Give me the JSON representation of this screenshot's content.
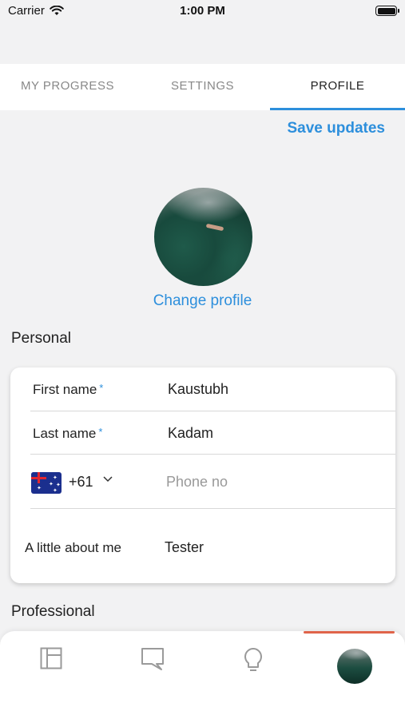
{
  "status_bar": {
    "carrier": "Carrier",
    "time": "1:00 PM"
  },
  "tabs": [
    {
      "label": "MY PROGRESS",
      "active": false
    },
    {
      "label": "SETTINGS",
      "active": false
    },
    {
      "label": "PROFILE",
      "active": true
    }
  ],
  "header": {
    "save_label": "Save updates"
  },
  "profile": {
    "change_label": "Change profile"
  },
  "sections": {
    "personal": "Personal",
    "professional": "Professional"
  },
  "form": {
    "first_name": {
      "label": "First name",
      "required_mark": "*",
      "value": "Kaustubh"
    },
    "last_name": {
      "label": "Last name",
      "required_mark": "*",
      "value": "Kadam"
    },
    "phone": {
      "country_code": "+61",
      "placeholder": "Phone no",
      "value": "",
      "flag_icon": "australia-flag-icon"
    },
    "about": {
      "label": "A little about me",
      "value": "Tester"
    }
  },
  "bottom_nav": [
    {
      "icon": "dashboard-icon"
    },
    {
      "icon": "chat-icon"
    },
    {
      "icon": "lightbulb-icon"
    },
    {
      "icon": "profile-avatar",
      "active": true
    }
  ],
  "colors": {
    "accent": "#2d8fdc",
    "nav_active_bar": "#e0644a",
    "background": "#f2f2f3"
  }
}
